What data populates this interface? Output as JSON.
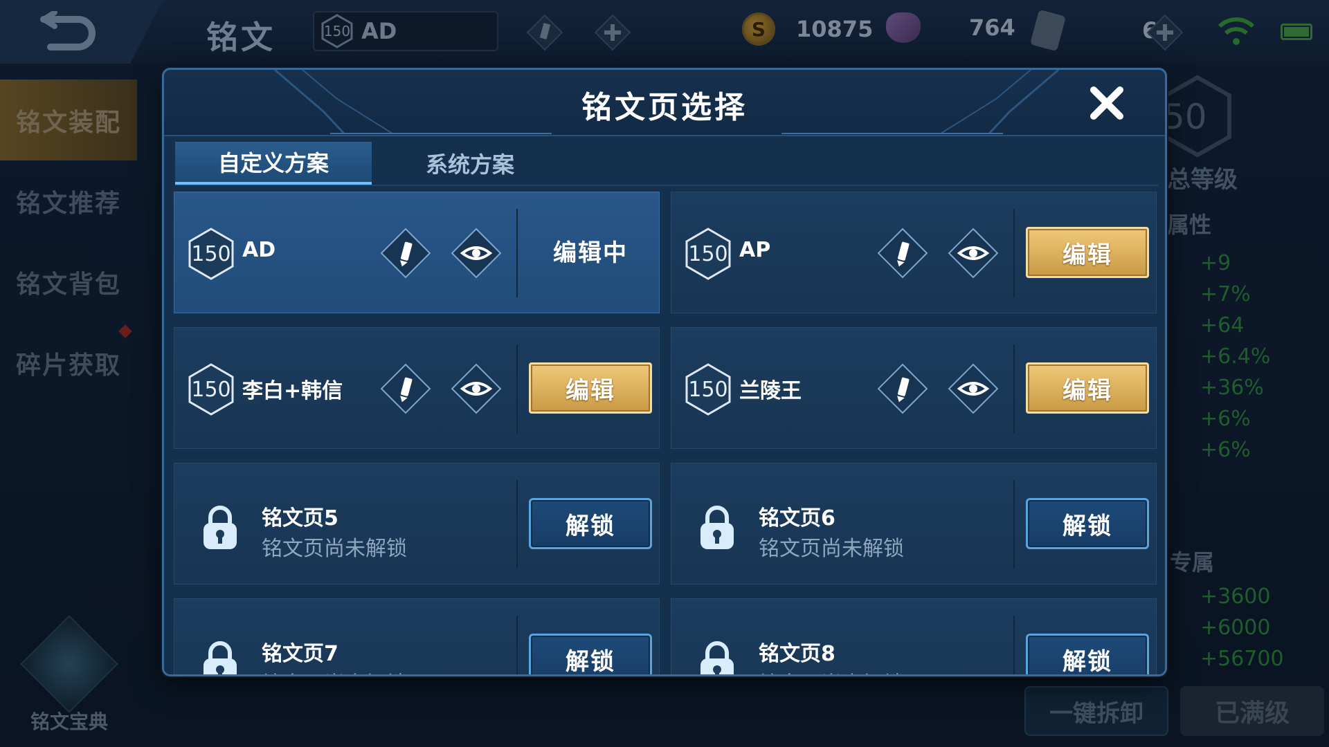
{
  "background": {
    "top_title": "铭文",
    "current_page": {
      "level": "150",
      "name": "AD"
    },
    "gold": "10875",
    "gems": "764",
    "cards": "6",
    "sidebar": [
      "铭文装配",
      "铭文推荐",
      "铭文背包",
      "碎片获取"
    ],
    "codex_label": "铭文宝典",
    "right_panel": {
      "level_num": "50",
      "total_level_label": "总等级",
      "attr_label": "属性",
      "stats": [
        "+9",
        "+7%",
        "+64",
        "+6.4%",
        "+36%",
        "+6%",
        "+6%"
      ],
      "exclusive_label": "专属",
      "stats2": [
        "+3600",
        "+6000",
        "+56700"
      ],
      "dismantle_label": "一键拆卸",
      "maxed_label": "已满级"
    }
  },
  "modal": {
    "title": "铭文页选择",
    "tabs": [
      {
        "label": "自定义方案",
        "active": true
      },
      {
        "label": "系统方案",
        "active": false
      }
    ],
    "pages": [
      {
        "level": "150",
        "name": "AD",
        "status": "editing",
        "action_label": "编辑中"
      },
      {
        "level": "150",
        "name": "AP",
        "status": "editable",
        "action_label": "编辑"
      },
      {
        "level": "150",
        "name": "李白+韩信",
        "status": "editable",
        "action_label": "编辑"
      },
      {
        "level": "150",
        "name": "兰陵王",
        "status": "editable",
        "action_label": "编辑"
      },
      {
        "name": "铭文页5",
        "status": "locked",
        "subtitle": "铭文页尚未解锁",
        "action_label": "解锁"
      },
      {
        "name": "铭文页6",
        "status": "locked",
        "subtitle": "铭文页尚未解锁",
        "action_label": "解锁"
      },
      {
        "name": "铭文页7",
        "status": "locked",
        "subtitle": "铭文页尚未解锁",
        "action_label": "解锁"
      },
      {
        "name": "铭文页8",
        "status": "locked",
        "subtitle": "铭文页尚未解锁",
        "action_label": "解锁"
      }
    ],
    "icons": {
      "close": "close-icon",
      "rename": "pencil-icon",
      "preview": "eye-icon",
      "lock": "lock-icon",
      "level": "hexagon-level-badge"
    },
    "colors": {
      "gold_button": "#e2b564",
      "unlock_border": "#5aa3df",
      "selected_card": "#285789"
    }
  }
}
